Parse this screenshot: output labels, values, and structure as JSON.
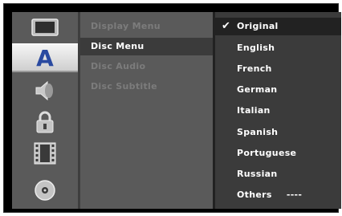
{
  "sidebar": {
    "icons": [
      {
        "name": "display-icon"
      },
      {
        "name": "language-icon",
        "label": "A"
      },
      {
        "name": "audio-icon"
      },
      {
        "name": "lock-icon"
      },
      {
        "name": "film-icon"
      },
      {
        "name": "disc-icon"
      }
    ],
    "selected_index": 1
  },
  "menu": {
    "items": [
      {
        "label": "Display Menu"
      },
      {
        "label": "Disc Menu"
      },
      {
        "label": "Disc Audio"
      },
      {
        "label": "Disc Subtitle"
      }
    ],
    "active_index": 1
  },
  "options": {
    "check_glyph": "✔",
    "items": [
      {
        "label": "Original",
        "checked": true
      },
      {
        "label": "English"
      },
      {
        "label": "French"
      },
      {
        "label": "German"
      },
      {
        "label": "Italian"
      },
      {
        "label": "Spanish"
      },
      {
        "label": "Portuguese"
      },
      {
        "label": "Russian"
      },
      {
        "label": "Others",
        "code": "----"
      }
    ]
  },
  "colors": {
    "panel": "#5a5a5a",
    "selected_panel": "#3b3b3b",
    "checked_row": "#222222",
    "text_active": "#ffffff",
    "text_dim": "#7c7c7c"
  }
}
